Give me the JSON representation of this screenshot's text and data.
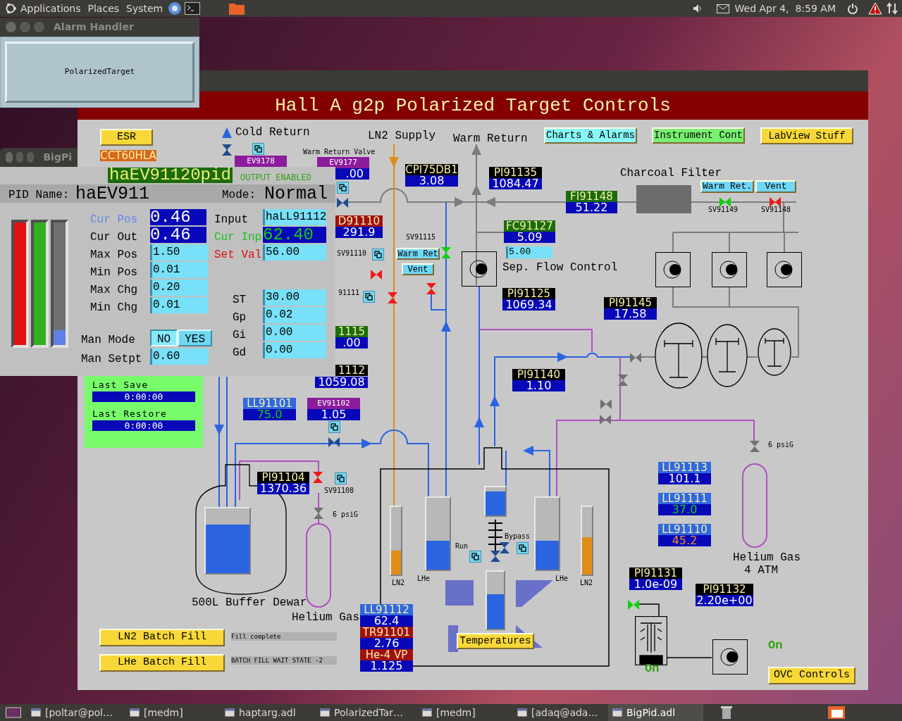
{
  "top_panel": {
    "menus": [
      "Applications",
      "Places",
      "System"
    ],
    "clock": "Wed Apr 4,  8:59 AM"
  },
  "alarm_window": {
    "title": "Alarm Handler",
    "button": "PolarizedTarget"
  },
  "main_window": {
    "title": "Hall A g2p Polarized Target Controls"
  },
  "buttons": [
    {
      "label": "ESR",
      "color": "#f8d838"
    },
    {
      "label": "Charts & Alarms",
      "color": "#88f8f8"
    },
    {
      "label": "Instrument Cont",
      "color": "#78f070"
    },
    {
      "label": "LabView Stuff",
      "color": "#f8d838"
    },
    {
      "label": "Warm Ret.",
      "color": "#70d8f8"
    },
    {
      "label": "Vent",
      "color": "#70d8f8"
    },
    {
      "label": "Warm Ret",
      "color": "#70d8f8"
    },
    {
      "label": "Vent",
      "color": "#70d8f8"
    },
    {
      "label": "LN2 Batch Fill",
      "color": "#f8d838"
    },
    {
      "label": "LHe Batch Fill",
      "color": "#f8d838"
    },
    {
      "label": "Temperatures",
      "color": "#f8d838"
    },
    {
      "label": "OVC Controls",
      "color": "#f8d838"
    }
  ],
  "readouts": [
    {
      "tag": "CCT60HLA",
      "color": "#d86818"
    },
    {
      "tag": "EV9178",
      "color": "#8c1c9c"
    },
    {
      "tag": "EV9177",
      "color": "#8c1c9c",
      "value": {
        "text": ".00"
      }
    },
    {
      "tag": "CPI75DB1",
      "color": "#000000",
      "value": {
        "text": "3.08"
      }
    },
    {
      "tag": "PI91135",
      "color": "#000000",
      "value": {
        "text": "1084.47"
      }
    },
    {
      "tag": "FI91148",
      "color": "#1c6c0c",
      "value": {
        "text": "51.22"
      }
    },
    {
      "tag": "D91110",
      "color": "#a01010",
      "value": {
        "text": "291.9"
      }
    },
    {
      "tag": "FC91127",
      "color": "#1c6c0c",
      "value": {
        "text": "5.09"
      }
    },
    {
      "tag": "PI91125",
      "color": "#000000",
      "value": {
        "text": "1069.34"
      }
    },
    {
      "tag": "PI91145",
      "color": "#000000",
      "value": {
        "text": "17.58"
      }
    },
    {
      "tag": "1115",
      "color": "#1c6c0c",
      "value": {
        "text": ".00"
      }
    },
    {
      "tag": "1112",
      "color": "#000000",
      "value": {
        "text": "1059.08"
      }
    },
    {
      "tag": "PI91140",
      "color": "#000000",
      "value": {
        "text": "1.10"
      }
    },
    {
      "tag": "LL91101",
      "color": "#3068e0",
      "value": {
        "text": "75.0",
        "kind": "normal"
      }
    },
    {
      "tag": "EV91102",
      "color": "#8c1c9c",
      "value": {
        "text": "1.05"
      }
    },
    {
      "tag": "PI91104",
      "color": "#000000",
      "value": {
        "text": "1370.36"
      }
    },
    {
      "tag": "LL91113",
      "color": "#3068e0",
      "value": {
        "text": "101.1"
      }
    },
    {
      "tag": "LL91111",
      "color": "#3068e0",
      "value": {
        "text": "37.0",
        "kind": "normal"
      }
    },
    {
      "tag": "LL91110",
      "color": "#3068e0",
      "value": {
        "text": "45.2",
        "kind": "warning"
      }
    },
    {
      "tag": "PI91131",
      "color": "#000000",
      "value": {
        "text": "1.0e-09"
      }
    },
    {
      "tag": "PI91132",
      "color": "#000000",
      "value": {
        "text": "2.20e+00"
      }
    },
    {
      "tag": "LL91112",
      "color": "#3068e0",
      "value": {
        "text": "62.4"
      }
    },
    {
      "tag": "TR91101",
      "color": "#a01010",
      "value": {
        "text": "2.76"
      }
    },
    {
      "tag": "He-4 VP",
      "color": "#a01010",
      "value": {
        "text": "1.125"
      }
    }
  ],
  "labels": [
    {
      "text": "Cold Return",
      "kind": "caption"
    },
    {
      "text": "LN2 Supply",
      "kind": "caption"
    },
    {
      "text": "Warm Return",
      "kind": "caption"
    },
    {
      "text": "Warm Return Valve",
      "kind": "tag"
    },
    {
      "text": "Charcoal Filter",
      "kind": "caption"
    },
    {
      "text": "SV91149",
      "kind": "tag"
    },
    {
      "text": "SV91148",
      "kind": "tag"
    },
    {
      "text": "SV91115",
      "kind": "tag"
    },
    {
      "text": "SV91110",
      "kind": "tag"
    },
    {
      "text": "Sep. Flow Control",
      "kind": "caption"
    },
    {
      "text": "91111",
      "kind": "tag"
    },
    {
      "text": "SV91108",
      "kind": "tag"
    },
    {
      "text": "6 psiG",
      "kind": "tag"
    },
    {
      "text": "500L Buffer Dewar",
      "kind": "caption"
    },
    {
      "text": "Helium Gas",
      "kind": "caption"
    },
    {
      "text": "LN2",
      "kind": "tag"
    },
    {
      "text": "LHe",
      "kind": "tag"
    },
    {
      "text": "Run",
      "kind": "tag"
    },
    {
      "text": "Bypass",
      "kind": "tag"
    },
    {
      "text": "LHe",
      "kind": "tag"
    },
    {
      "text": "LN2",
      "kind": "tag"
    },
    {
      "text": "6 psiG",
      "kind": "tag"
    },
    {
      "text": "Helium Gas",
      "kind": "caption"
    },
    {
      "text": "4 ATM",
      "kind": "caption"
    },
    {
      "text": "On",
      "kind": "status"
    },
    {
      "text": "On",
      "kind": "status"
    }
  ],
  "valves": [
    {
      "color": "#204c90"
    },
    {
      "color": "#204c90"
    },
    {
      "color": "#f01818"
    },
    {
      "color": "#f01818"
    },
    {
      "color": "#f01818"
    },
    {
      "color": "#10d010"
    },
    {
      "color": "#10d010"
    },
    {
      "color": "#f01818"
    },
    {
      "color": "#204c90"
    },
    {
      "color": "#f01818"
    },
    {
      "color": "#10d010"
    },
    {
      "color": "#204c90"
    },
    {
      "color": "#204c90"
    },
    {
      "color": "#707070"
    },
    {
      "color": "#707070"
    },
    {
      "color": "#707070"
    },
    {
      "color": "#707070"
    },
    {
      "color": "#707070"
    },
    {
      "color": "#707070"
    }
  ],
  "gauges": [
    {
      "level": 0.75,
      "color": "#2a64e0"
    },
    {
      "level": 0.35,
      "color": "#e08c18"
    },
    {
      "level": 0.4,
      "color": "#2a64e0"
    },
    {
      "level": 0.85,
      "color": "#2a64e0"
    },
    {
      "level": 0.6,
      "color": "#2a64e0"
    },
    {
      "level": 0.4,
      "color": "#2a64e0"
    },
    {
      "level": 0.55,
      "color": "#e08c18"
    }
  ],
  "setpoint_field": {
    "value": "5.00"
  },
  "save_panel": [
    {
      "label": "Last Save",
      "value": "0:00:00"
    },
    {
      "label": "Last Restore",
      "value": "0:00:00"
    }
  ],
  "fill_status": [
    "Fill complete",
    "BATCH FILL WAIT STATE -2"
  ],
  "pid_window": {
    "title": "BigPi",
    "record": "haEV91120pid",
    "output_status": "OUTPUT ENABLED",
    "name_label": "PID Name:",
    "name": "haEV911",
    "mode_label": "Mode:",
    "mode": "Normal",
    "bars": [
      {
        "level": 1,
        "color": "#e01010"
      },
      {
        "level": 1,
        "color": "#30b020"
      },
      {
        "level": 0.12,
        "color": "#6080e8"
      }
    ],
    "left_rows": [
      {
        "label": "Cur Pos",
        "value": "0.46",
        "kind": "readback",
        "color": "#6888e8"
      },
      {
        "label": "Cur Out",
        "value": "0.46",
        "kind": "readback",
        "color": "#000000"
      },
      {
        "label": "Max Pos",
        "value": "1.50",
        "kind": "entry",
        "color": "#000000"
      },
      {
        "label": "Min Pos",
        "value": "0.01",
        "kind": "entry",
        "color": "#000000"
      },
      {
        "label": "Max Chg",
        "value": "0.20",
        "kind": "entry",
        "color": "#000000"
      },
      {
        "label": "Min Chg",
        "value": "0.01",
        "kind": "entry",
        "color": "#000000"
      }
    ],
    "right_rows": [
      {
        "label": "Input",
        "value": {
          "text": "haLL91112"
        },
        "kind": "entry",
        "color": "#000000"
      },
      {
        "label": "Cur Inp",
        "value": {
          "text": "62.40",
          "kind": "normal"
        },
        "kind": "readback",
        "color": "#20c020"
      },
      {
        "label": "Set Val",
        "value": {
          "text": "56.00"
        },
        "kind": "entry",
        "color": "#e01010"
      }
    ],
    "gain_rows": [
      {
        "label": "ST",
        "value": "30.00"
      },
      {
        "label": "Gp",
        "value": "0.02"
      },
      {
        "label": "Gi",
        "value": "0.00"
      },
      {
        "label": "Gd",
        "value": "0.00"
      }
    ],
    "man_mode": {
      "label": "Man Mode",
      "options": [
        {
          "label": "NO",
          "selected": true
        },
        {
          "label": "YES",
          "selected": false
        }
      ]
    },
    "man_setpt": {
      "label": "Man Setpt",
      "value": "0.60"
    }
  },
  "taskbar": [
    {
      "label": "[poltar@pol…",
      "selected": false
    },
    {
      "label": "[medm]",
      "selected": false
    },
    {
      "label": "haptarg.adl",
      "selected": false
    },
    {
      "label": "PolarizedTar…",
      "selected": false
    },
    {
      "label": "[medm]",
      "selected": false
    },
    {
      "label": "[adaq@ada…",
      "selected": false
    },
    {
      "label": "BigPid.adl",
      "selected": true
    }
  ]
}
